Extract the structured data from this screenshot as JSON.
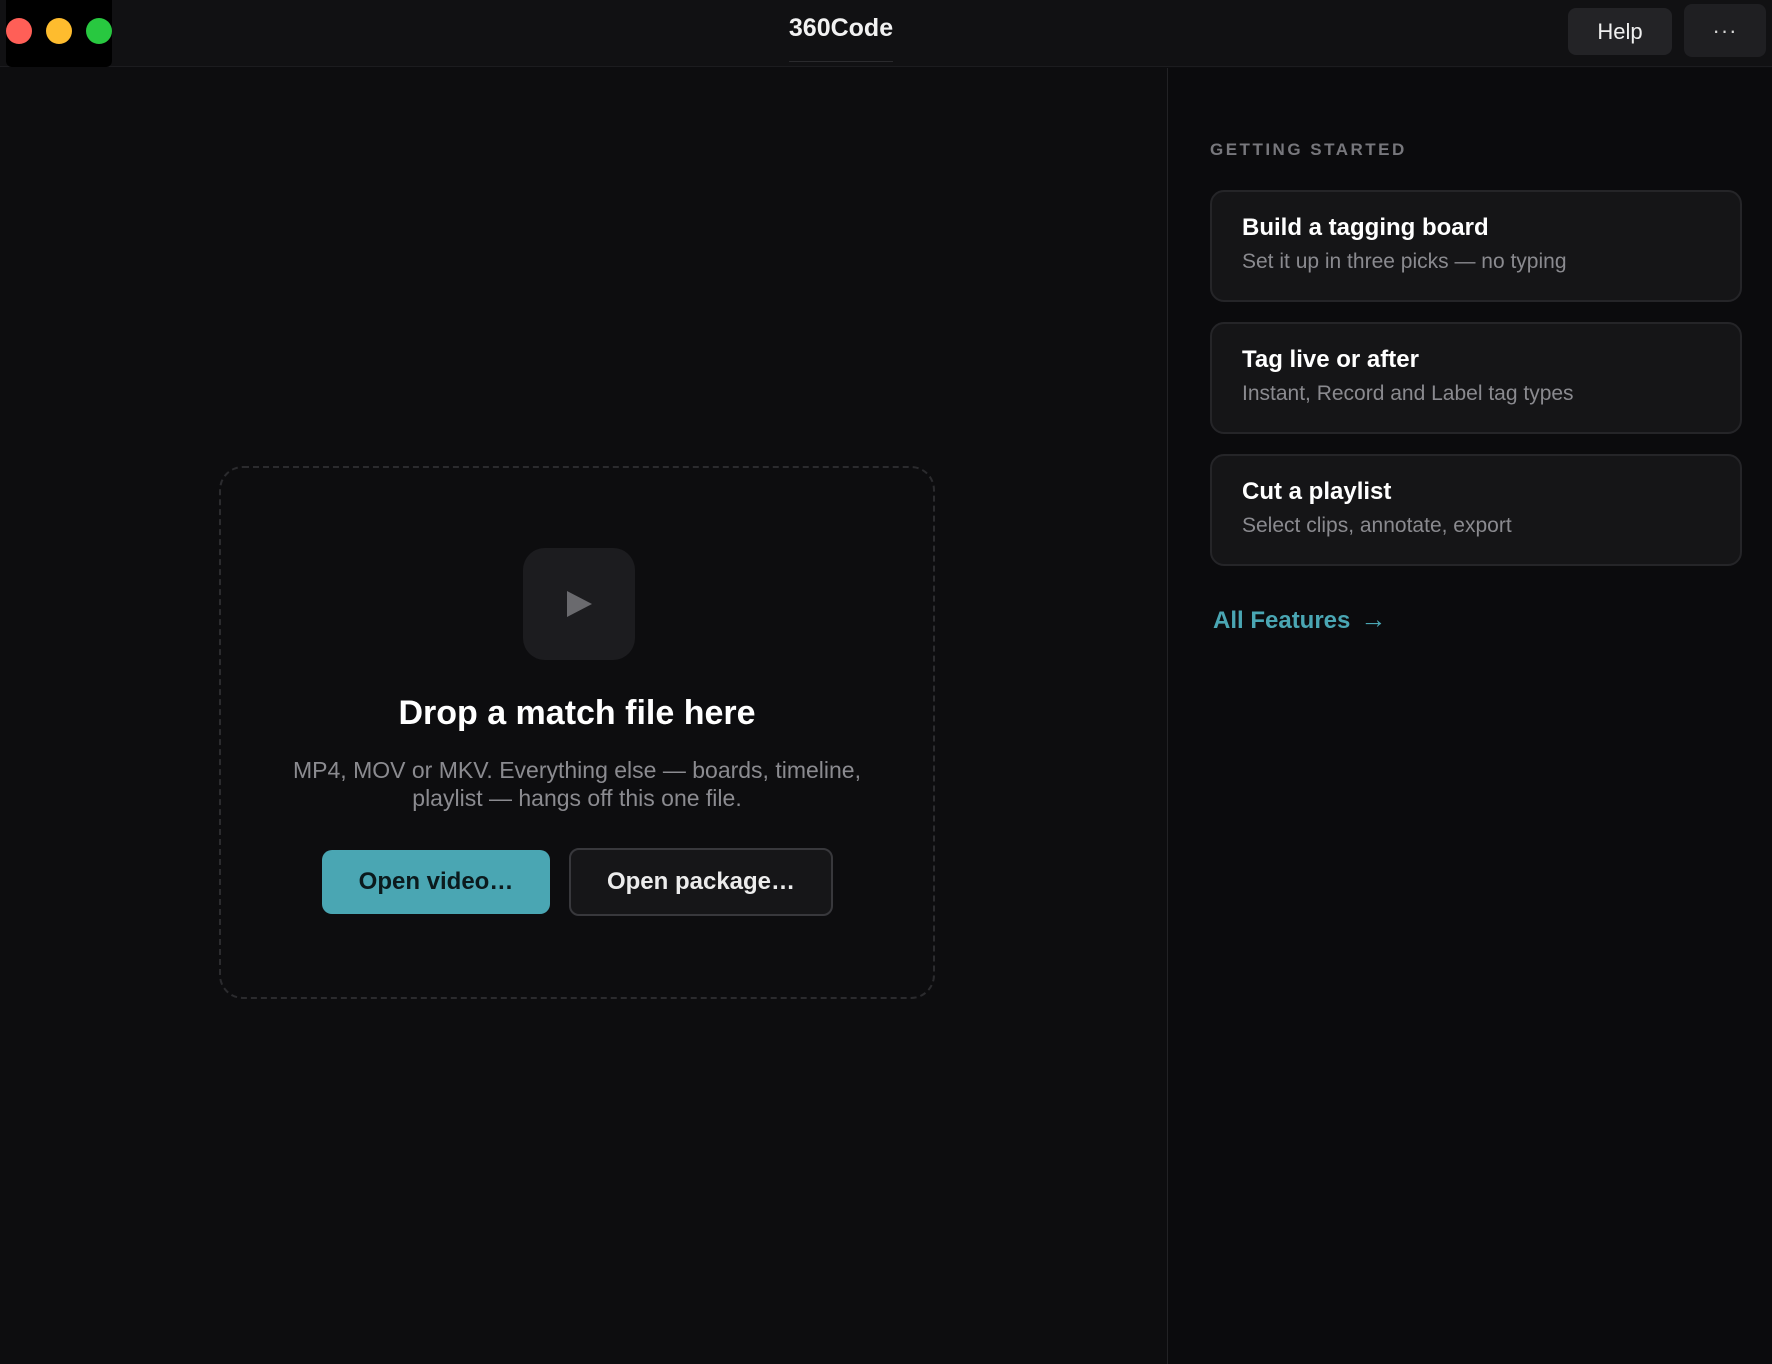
{
  "window": {
    "title": "360Code",
    "controls": {
      "close_color": "#ff5f57",
      "minimize_color": "#febc2e",
      "zoom_color": "#28c840"
    },
    "help_label": "Help",
    "more_label": "···"
  },
  "dropzone": {
    "icon": "play-icon",
    "title": "Drop a match file here",
    "subtitle": "MP4, MOV or MKV. Everything else — boards, timeline, playlist — hangs off this one file.",
    "open_video_label": "Open video…",
    "open_package_label": "Open package…"
  },
  "sidebar": {
    "section_label": "GETTING STARTED",
    "cards": [
      {
        "title": "Build a tagging board",
        "subtitle": "Set it up in three picks — no typing"
      },
      {
        "title": "Tag live or after",
        "subtitle": "Instant, Record and Label tag types"
      },
      {
        "title": "Cut a playlist",
        "subtitle": "Select clips, annotate, export"
      }
    ],
    "all_features_label": "All Features",
    "all_features_arrow": "→"
  },
  "colors": {
    "accent": "#4aa6b3",
    "background": "#0d0d0f",
    "card_background": "#151517"
  }
}
